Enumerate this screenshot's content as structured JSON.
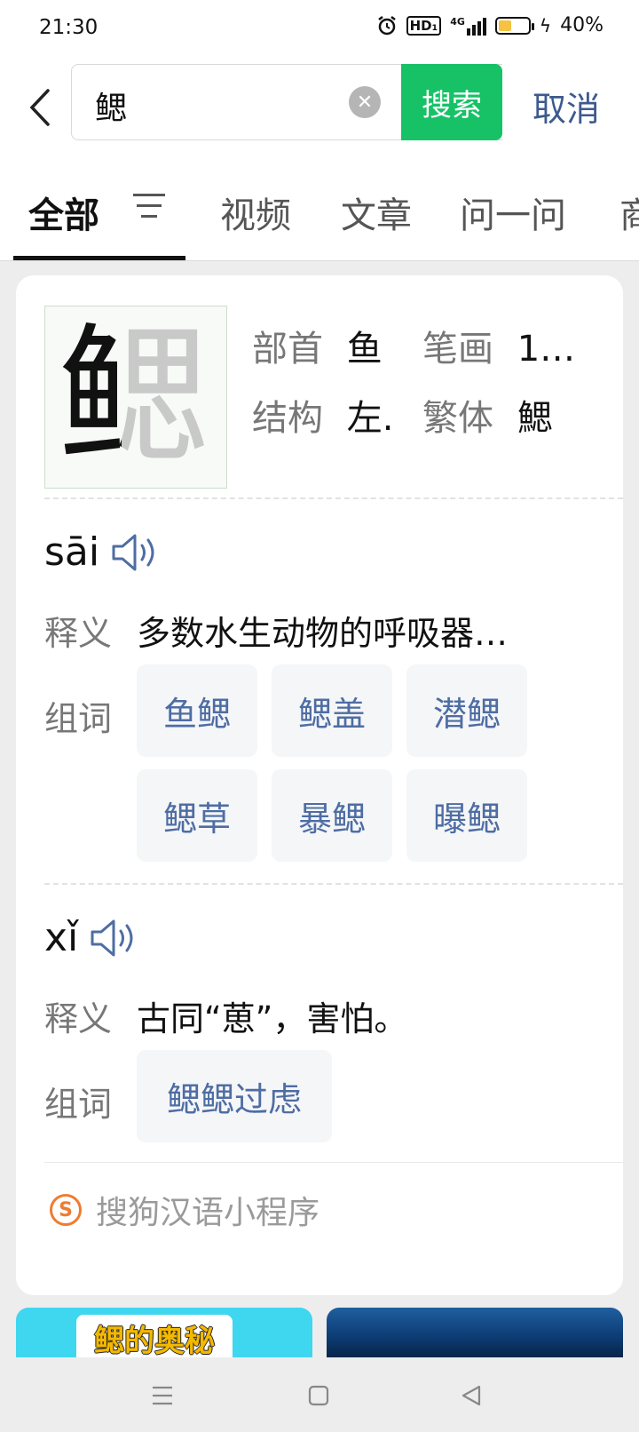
{
  "status_bar": {
    "time": "21:30",
    "network": "HD₁",
    "net_gen": "4G",
    "battery": "40%",
    "battery_level": 0.4
  },
  "search": {
    "query": "鳃",
    "search_label": "搜索",
    "cancel_label": "取消"
  },
  "tabs": [
    {
      "label": "全部",
      "active": true
    },
    {
      "label": "视频"
    },
    {
      "label": "文章"
    },
    {
      "label": "问一问"
    },
    {
      "label": "商"
    }
  ],
  "dictionary": {
    "character": "鳃",
    "radical_label": "部首",
    "radical": "鱼",
    "strokes_label": "笔画",
    "strokes": "1…",
    "structure_label": "结构",
    "structure": "左.",
    "traditional_label": "繁体",
    "traditional": "鰓",
    "readings": [
      {
        "pinyin": "sāi",
        "meaning_label": "释义",
        "meaning": "多数水生动物的呼吸器…",
        "words_label": "组词",
        "words": [
          "鱼鳃",
          "鳃盖",
          "潜鳃",
          "鳃草",
          "暴鳃",
          "曝鳃"
        ]
      },
      {
        "pinyin": "xǐ",
        "meaning_label": "释义",
        "meaning": "古同“葸”，害怕。",
        "words_label": "组词",
        "words": [
          "鳃鳃过虑"
        ]
      }
    ],
    "source": "搜狗汉语小程序"
  },
  "results": [
    {
      "title": "鳃的奥秘"
    },
    {
      "title": ""
    }
  ]
}
